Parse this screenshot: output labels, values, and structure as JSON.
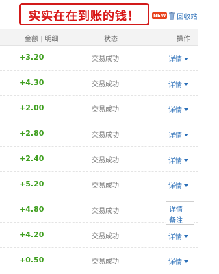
{
  "banner": {
    "text": "实实在在到账的钱！"
  },
  "recycle": {
    "badge": "NEW",
    "label": "回收站"
  },
  "table": {
    "headers": {
      "amount": "金额",
      "detail": "明细",
      "status": "状态",
      "operation": "操作"
    },
    "rows": [
      {
        "amount": "+3.20",
        "status": "交易成功",
        "action": "详情"
      },
      {
        "amount": "+4.30",
        "status": "交易成功",
        "action": "详情"
      },
      {
        "amount": "+2.00",
        "status": "交易成功",
        "action": "详情"
      },
      {
        "amount": "+2.80",
        "status": "交易成功",
        "action": "详情"
      },
      {
        "amount": "+2.40",
        "status": "交易成功",
        "action": "详情"
      },
      {
        "amount": "+5.20",
        "status": "交易成功",
        "action": "详情"
      },
      {
        "amount": "+4.80",
        "status": "交易成功",
        "action": "详情"
      },
      {
        "amount": "+4.20",
        "status": "交易成功",
        "action": "详情"
      },
      {
        "amount": "+0.50",
        "status": "交易成功",
        "action": "详情"
      }
    ]
  },
  "dropdown": {
    "items": [
      "详情",
      "备注"
    ]
  },
  "colors": {
    "amount": "#3f9f1f",
    "link": "#2b6fb8",
    "banner": "#d81616"
  }
}
